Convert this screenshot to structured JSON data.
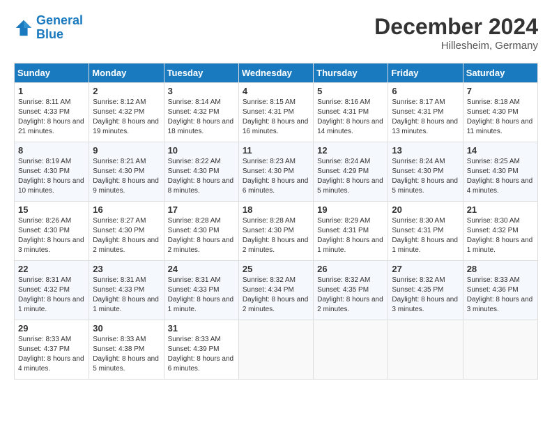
{
  "header": {
    "logo_line1": "General",
    "logo_line2": "Blue",
    "month_title": "December 2024",
    "location": "Hillesheim, Germany"
  },
  "days_of_week": [
    "Sunday",
    "Monday",
    "Tuesday",
    "Wednesday",
    "Thursday",
    "Friday",
    "Saturday"
  ],
  "weeks": [
    [
      {
        "day": "1",
        "sunrise": "8:11 AM",
        "sunset": "4:33 PM",
        "daylight": "8 hours and 21 minutes."
      },
      {
        "day": "2",
        "sunrise": "8:12 AM",
        "sunset": "4:32 PM",
        "daylight": "8 hours and 19 minutes."
      },
      {
        "day": "3",
        "sunrise": "8:14 AM",
        "sunset": "4:32 PM",
        "daylight": "8 hours and 18 minutes."
      },
      {
        "day": "4",
        "sunrise": "8:15 AM",
        "sunset": "4:31 PM",
        "daylight": "8 hours and 16 minutes."
      },
      {
        "day": "5",
        "sunrise": "8:16 AM",
        "sunset": "4:31 PM",
        "daylight": "8 hours and 14 minutes."
      },
      {
        "day": "6",
        "sunrise": "8:17 AM",
        "sunset": "4:31 PM",
        "daylight": "8 hours and 13 minutes."
      },
      {
        "day": "7",
        "sunrise": "8:18 AM",
        "sunset": "4:30 PM",
        "daylight": "8 hours and 11 minutes."
      }
    ],
    [
      {
        "day": "8",
        "sunrise": "8:19 AM",
        "sunset": "4:30 PM",
        "daylight": "8 hours and 10 minutes."
      },
      {
        "day": "9",
        "sunrise": "8:21 AM",
        "sunset": "4:30 PM",
        "daylight": "8 hours and 9 minutes."
      },
      {
        "day": "10",
        "sunrise": "8:22 AM",
        "sunset": "4:30 PM",
        "daylight": "8 hours and 8 minutes."
      },
      {
        "day": "11",
        "sunrise": "8:23 AM",
        "sunset": "4:30 PM",
        "daylight": "8 hours and 6 minutes."
      },
      {
        "day": "12",
        "sunrise": "8:24 AM",
        "sunset": "4:29 PM",
        "daylight": "8 hours and 5 minutes."
      },
      {
        "day": "13",
        "sunrise": "8:24 AM",
        "sunset": "4:30 PM",
        "daylight": "8 hours and 5 minutes."
      },
      {
        "day": "14",
        "sunrise": "8:25 AM",
        "sunset": "4:30 PM",
        "daylight": "8 hours and 4 minutes."
      }
    ],
    [
      {
        "day": "15",
        "sunrise": "8:26 AM",
        "sunset": "4:30 PM",
        "daylight": "8 hours and 3 minutes."
      },
      {
        "day": "16",
        "sunrise": "8:27 AM",
        "sunset": "4:30 PM",
        "daylight": "8 hours and 2 minutes."
      },
      {
        "day": "17",
        "sunrise": "8:28 AM",
        "sunset": "4:30 PM",
        "daylight": "8 hours and 2 minutes."
      },
      {
        "day": "18",
        "sunrise": "8:28 AM",
        "sunset": "4:30 PM",
        "daylight": "8 hours and 2 minutes."
      },
      {
        "day": "19",
        "sunrise": "8:29 AM",
        "sunset": "4:31 PM",
        "daylight": "8 hours and 1 minute."
      },
      {
        "day": "20",
        "sunrise": "8:30 AM",
        "sunset": "4:31 PM",
        "daylight": "8 hours and 1 minute."
      },
      {
        "day": "21",
        "sunrise": "8:30 AM",
        "sunset": "4:32 PM",
        "daylight": "8 hours and 1 minute."
      }
    ],
    [
      {
        "day": "22",
        "sunrise": "8:31 AM",
        "sunset": "4:32 PM",
        "daylight": "8 hours and 1 minute."
      },
      {
        "day": "23",
        "sunrise": "8:31 AM",
        "sunset": "4:33 PM",
        "daylight": "8 hours and 1 minute."
      },
      {
        "day": "24",
        "sunrise": "8:31 AM",
        "sunset": "4:33 PM",
        "daylight": "8 hours and 1 minute."
      },
      {
        "day": "25",
        "sunrise": "8:32 AM",
        "sunset": "4:34 PM",
        "daylight": "8 hours and 2 minutes."
      },
      {
        "day": "26",
        "sunrise": "8:32 AM",
        "sunset": "4:35 PM",
        "daylight": "8 hours and 2 minutes."
      },
      {
        "day": "27",
        "sunrise": "8:32 AM",
        "sunset": "4:35 PM",
        "daylight": "8 hours and 3 minutes."
      },
      {
        "day": "28",
        "sunrise": "8:33 AM",
        "sunset": "4:36 PM",
        "daylight": "8 hours and 3 minutes."
      }
    ],
    [
      {
        "day": "29",
        "sunrise": "8:33 AM",
        "sunset": "4:37 PM",
        "daylight": "8 hours and 4 minutes."
      },
      {
        "day": "30",
        "sunrise": "8:33 AM",
        "sunset": "4:38 PM",
        "daylight": "8 hours and 5 minutes."
      },
      {
        "day": "31",
        "sunrise": "8:33 AM",
        "sunset": "4:39 PM",
        "daylight": "8 hours and 6 minutes."
      },
      null,
      null,
      null,
      null
    ]
  ],
  "labels": {
    "sunrise": "Sunrise:",
    "sunset": "Sunset:",
    "daylight": "Daylight:"
  }
}
